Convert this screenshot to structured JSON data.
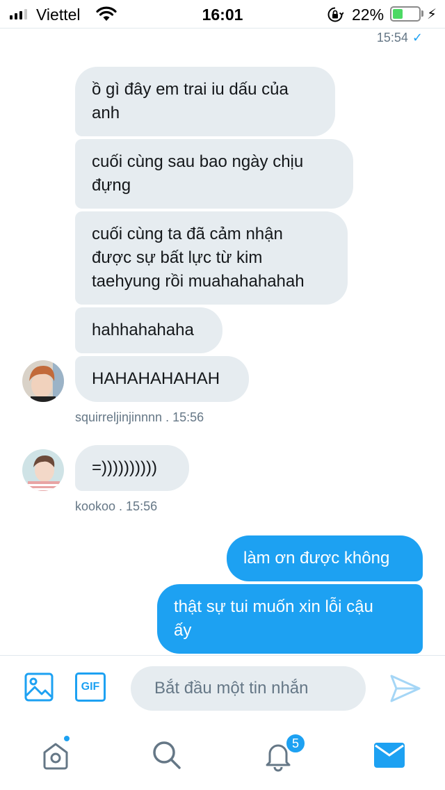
{
  "status_bar": {
    "carrier": "Viettel",
    "time": "16:01",
    "battery_percent": "22%",
    "battery_level": 0.22
  },
  "conversation": {
    "top_timestamp": "15:54",
    "top_read_mark": "✓",
    "messages": [
      {
        "from": "squirreljinjinnnn",
        "text": "ồ gì đây em trai iu dấu của\nanh"
      },
      {
        "from": "squirreljinjinnnn",
        "text": "cuối cùng sau bao ngày chịu\nđựng"
      },
      {
        "from": "squirreljinjinnnn",
        "text": "cuối cùng ta đã cảm nhận\nđược sự bất lực từ kim\ntaehyung rồi muahahahahah"
      },
      {
        "from": "squirreljinjinnnn",
        "text": "hahhahahaha"
      },
      {
        "from": "squirreljinjinnnn",
        "text": "HAHAHAHAHAH"
      },
      {
        "from": "kookoo",
        "text": "=))))))))))"
      },
      {
        "from": "me",
        "text": "làm ơn được không"
      },
      {
        "from": "me",
        "text": "thật sự tui muốn xin lỗi cậu\nấy"
      }
    ],
    "meta_1": "squirreljinjinnnn . 15:56",
    "meta_2": "kookoo . 15:56"
  },
  "composer": {
    "placeholder": "Bắt đầu một tin nhắn",
    "gif_label": "GIF",
    "icons": [
      "image-icon",
      "gif-icon",
      "send-icon"
    ]
  },
  "tab_bar": {
    "notifications_badge": "5",
    "icons": [
      "home-icon",
      "search-icon",
      "bell-icon",
      "mail-icon"
    ]
  },
  "colors": {
    "accent": "#1da1f2",
    "incoming_bubble": "#e6ecf0",
    "meta_text": "#657786"
  }
}
